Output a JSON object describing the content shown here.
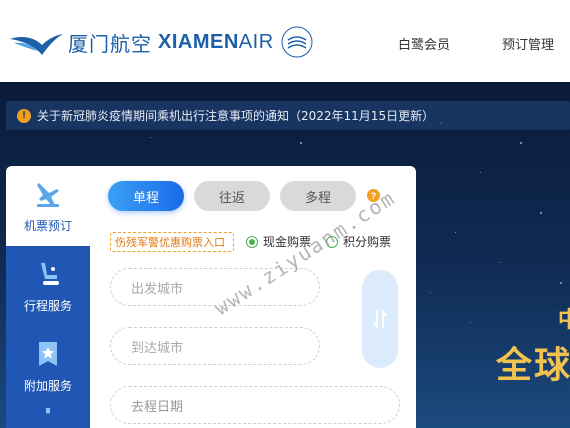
{
  "header": {
    "logo_cn": "厦门航空",
    "logo_en_bold": "XIAMEN",
    "logo_en_light": "AIR",
    "seal_text": "SKYTEAM",
    "nav": [
      {
        "label": "白鹭会员"
      },
      {
        "label": "预订管理"
      }
    ]
  },
  "notice": {
    "icon": "!",
    "text": "关于新冠肺炎疫情期间乘机出行注意事项的通知（2022年11月15日更新）"
  },
  "sidebar": {
    "items": [
      {
        "label": "机票预订",
        "icon": "plane-ticket-icon",
        "active": true
      },
      {
        "label": "行程服务",
        "icon": "seat-icon"
      },
      {
        "label": "附加服务",
        "icon": "star-badge-icon"
      }
    ]
  },
  "booking": {
    "tabs": [
      {
        "label": "单程",
        "active": true
      },
      {
        "label": "往返"
      },
      {
        "label": "多程"
      }
    ],
    "help": "?",
    "promo_link": "伤残军警优惠购票入口",
    "payment_options": [
      {
        "label": "现金购票",
        "checked": true
      },
      {
        "label": "积分购票",
        "checked": false
      }
    ],
    "departure_placeholder": "出发城市",
    "arrival_placeholder": "到达城市",
    "date_placeholder": "去程日期"
  },
  "banner": {
    "headline": "全球",
    "headline_top": "中"
  },
  "watermark": "www.ziyuanm.com",
  "colors": {
    "brand_blue": "#1b60a8",
    "sidebar_blue": "#2057b5",
    "accent_orange": "#f0a020",
    "gold": "#f2c14e"
  }
}
